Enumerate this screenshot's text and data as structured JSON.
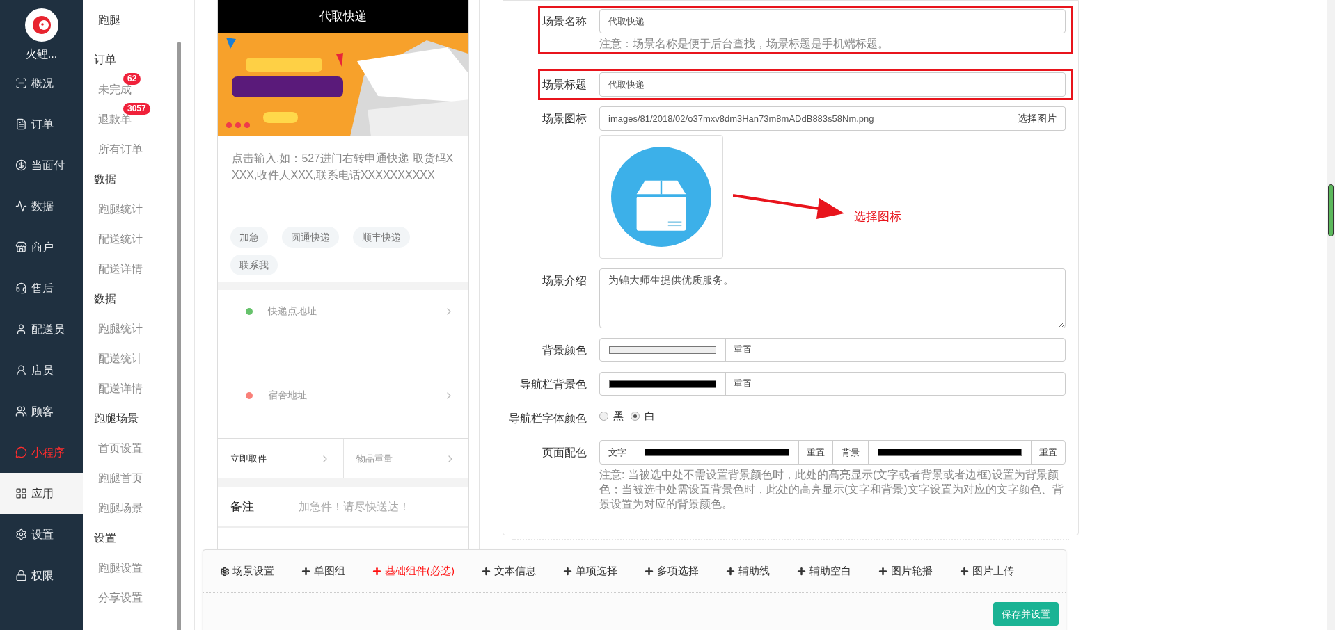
{
  "brand": {
    "name": "火鲤..."
  },
  "nav": [
    {
      "label": "概况",
      "selected": false,
      "kind": "normal"
    },
    {
      "label": "订单",
      "selected": false,
      "kind": "normal"
    },
    {
      "label": "当面付",
      "selected": false,
      "kind": "normal"
    },
    {
      "label": "数据",
      "selected": false,
      "kind": "normal"
    },
    {
      "label": "商户",
      "selected": false,
      "kind": "normal"
    },
    {
      "label": "售后",
      "selected": false,
      "kind": "normal"
    },
    {
      "label": "配送员",
      "selected": false,
      "kind": "normal"
    },
    {
      "label": "店员",
      "selected": false,
      "kind": "normal"
    },
    {
      "label": "顾客",
      "selected": false,
      "kind": "normal"
    },
    {
      "label": "小程序",
      "selected": false,
      "kind": "accent"
    },
    {
      "label": "应用",
      "selected": true,
      "kind": "normal"
    },
    {
      "label": "设置",
      "selected": false,
      "kind": "normal"
    },
    {
      "label": "权限",
      "selected": false,
      "kind": "normal"
    }
  ],
  "subnav": {
    "title": "跑腿",
    "groups": [
      {
        "title": "订单",
        "items": [
          {
            "label": "未完成",
            "badge": "62"
          },
          {
            "label": "退款单",
            "badge": "3057"
          },
          {
            "label": "所有订单"
          }
        ]
      },
      {
        "title": "数据",
        "items": [
          {
            "label": "跑腿统计"
          },
          {
            "label": "配送统计"
          },
          {
            "label": "配送详情"
          }
        ]
      },
      {
        "title": "数据",
        "items": [
          {
            "label": "跑腿统计"
          },
          {
            "label": "配送统计"
          },
          {
            "label": "配送详情"
          }
        ]
      },
      {
        "title": "跑腿场景",
        "items": [
          {
            "label": "首页设置"
          },
          {
            "label": "跑腿首页"
          },
          {
            "label": "跑腿场景"
          }
        ]
      },
      {
        "title": "设置",
        "items": [
          {
            "label": "跑腿设置"
          },
          {
            "label": "分享设置"
          }
        ]
      }
    ]
  },
  "preview": {
    "title": "代取快递",
    "banner": {
      "kind": "picture"
    },
    "hint": "点击输入,如：527进门右转申通快递 取货码XXXX,收件人XXX,联系电话XXXXXXXXXX",
    "tags": [
      "加急",
      "圆通快递",
      "顺丰快递",
      "联系我"
    ],
    "addresses": [
      {
        "label": "快递点地址",
        "color": "#66c26b"
      },
      {
        "label": "宿舍地址",
        "color": "#f98079"
      }
    ],
    "options": [
      {
        "label": "立即取件",
        "filled": true
      },
      {
        "label": "物品重量",
        "filled": false
      }
    ],
    "remark": {
      "label": "备注",
      "placeholder": "加急件！请尽快送达！"
    }
  },
  "form": {
    "fields": [
      {
        "kind": "text",
        "label": "场景名称",
        "value": "代取快递",
        "note": "注意：场景名称是便于后台查找，场景标题是手机端标题。",
        "annotated": true
      },
      {
        "kind": "text",
        "label": "场景标题",
        "value": "代取快递",
        "annotated": true
      },
      {
        "label": "场景图标",
        "value": "images/81/2018/02/o37mxv8dm3Han73m8mADdB883s58Nm.png",
        "button": "选择图片",
        "callout": "选择图标",
        "annotated": false
      },
      {
        "kind": "textarea",
        "label": "场景介绍",
        "value": "为锦大师生提供优质服务。",
        "annotated": false
      },
      {
        "kind": "color",
        "label": "背景颜色",
        "color": "#eeeeee",
        "button": "重置",
        "annotated": false
      },
      {
        "kind": "color",
        "label": "导航栏背景色",
        "color": "#000000",
        "button": "重置",
        "annotated": false
      },
      {
        "kind": "radio",
        "label": "导航栏字体颜色",
        "options": [
          {
            "label": "黑",
            "selected": false
          },
          {
            "label": "白",
            "selected": true
          }
        ],
        "annotated": false
      },
      {
        "kind": "pair",
        "label": "页面配色",
        "parts": [
          {
            "label": "文字",
            "color": "#000000",
            "button": "重置"
          },
          {
            "label": "背景",
            "color": "#000000",
            "button": "重置"
          }
        ],
        "note": "注意: 当被选中处不需设置背景颜色时，此处的高亮显示(文字或者背景或者边框)设置为背景颜色；当被选中处需设置背景色时，此处的高亮显示(文字和背景)文字设置为对应的文字颜色、背景设置为对应的背景颜色。",
        "annotated": false
      }
    ]
  },
  "toolbar": {
    "items": [
      {
        "label": "场景设置",
        "kind": "gear",
        "required": false
      },
      {
        "label": "单图组",
        "kind": "plus",
        "required": false
      },
      {
        "label": "基础组件(必选)",
        "kind": "plus",
        "required": true
      },
      {
        "label": "文本信息",
        "kind": "plus",
        "required": false
      },
      {
        "label": "单项选择",
        "kind": "plus",
        "required": false
      },
      {
        "label": "多项选择",
        "kind": "plus",
        "required": false
      },
      {
        "label": "辅助线",
        "kind": "plus",
        "required": false
      },
      {
        "label": "辅助空白",
        "kind": "plus",
        "required": false
      },
      {
        "label": "图片轮播",
        "kind": "plus",
        "required": false
      },
      {
        "label": "图片上传",
        "kind": "plus",
        "required": false
      }
    ],
    "save": "保存并设置"
  }
}
